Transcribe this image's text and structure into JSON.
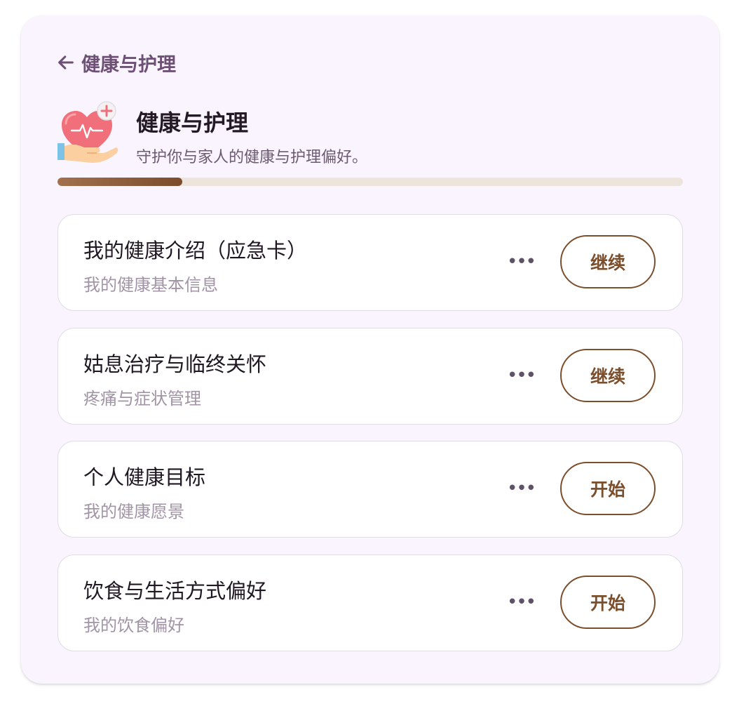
{
  "nav": {
    "back_label": "健康与护理"
  },
  "header": {
    "icon": "heart-in-hand-icon",
    "title": "健康与护理",
    "subtitle": "守护你与家人的健康与护理偏好。"
  },
  "progress": {
    "fraction": 0.2
  },
  "colors": {
    "panel_bg": "#f9f4fd",
    "accent_brown": "#7b4e2c",
    "title_purple": "#6e4f75"
  },
  "cards": [
    {
      "title": "我的健康介绍（应急卡）",
      "subtitle": "我的健康基本信息",
      "more": "•••",
      "action": "继续"
    },
    {
      "title": "姑息治疗与临终关怀",
      "subtitle": "疼痛与症状管理",
      "more": "•••",
      "action": "继续"
    },
    {
      "title": "个人健康目标",
      "subtitle": "我的健康愿景",
      "more": "•••",
      "action": "开始"
    },
    {
      "title": "饮食与生活方式偏好",
      "subtitle": "我的饮食偏好",
      "more": "•••",
      "action": "开始"
    }
  ]
}
